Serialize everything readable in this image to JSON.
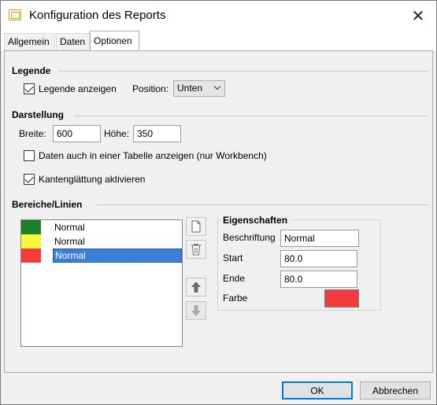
{
  "window": {
    "title": "Konfiguration des Reports",
    "close_label": "✕"
  },
  "tabs": [
    {
      "label": "Allgemein",
      "active": false
    },
    {
      "label": "Daten",
      "active": false
    },
    {
      "label": "Optionen",
      "active": true
    }
  ],
  "legend": {
    "section_title": "Legende",
    "show_label": "Legende anzeigen",
    "show_checked": true,
    "position_label": "Position:",
    "position_value": "Unten"
  },
  "display": {
    "section_title": "Darstellung",
    "width_label": "Breite:",
    "width_value": "600",
    "height_label": "Höhe:",
    "height_value": "350",
    "table_label": "Daten auch in einer Tabelle anzeigen (nur Workbench)",
    "table_checked": false,
    "antialias_label": "Kantenglättung aktivieren",
    "antialias_checked": true
  },
  "ranges": {
    "section_title": "Bereiche/Linien",
    "items": [
      {
        "label": "Normal",
        "color": "#1a7f25",
        "selected": false
      },
      {
        "label": "Normal",
        "color": "#f8f83a",
        "selected": false
      },
      {
        "label": "Normal",
        "color": "#f33b3b",
        "selected": true
      }
    ],
    "toolbar": [
      "new-file-icon",
      "trash-icon",
      "arrow-up-icon",
      "arrow-down-icon"
    ]
  },
  "properties": {
    "title": "Eigenschaften",
    "caption_label": "Beschriftung",
    "caption_value": "Normal",
    "start_label": "Start",
    "start_value": "80.0",
    "end_label": "Ende",
    "end_value": "80.0",
    "color_label": "Farbe",
    "color_value": "#f33b3b"
  },
  "buttons": {
    "ok": "OK",
    "cancel": "Abbrechen"
  }
}
